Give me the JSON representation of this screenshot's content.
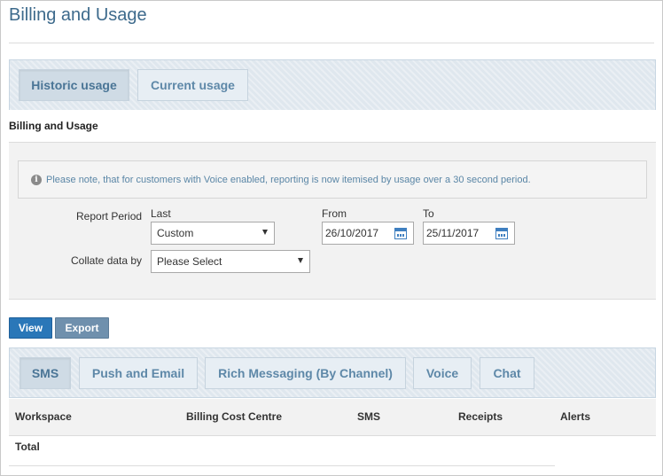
{
  "page": {
    "title": "Billing and Usage"
  },
  "usage_tabs": [
    {
      "label": "Historic usage",
      "active": true
    },
    {
      "label": "Current usage",
      "active": false
    }
  ],
  "section": {
    "label": "Billing and Usage"
  },
  "notice": {
    "text": "Please note, that for customers with Voice enabled, reporting is now itemised by usage over a 30 second period."
  },
  "form": {
    "report_period_label": "Report Period",
    "last_label": "Last",
    "last_value": "Custom",
    "from_label": "From",
    "from_value": "26/10/2017",
    "to_label": "To",
    "to_value": "25/11/2017",
    "collate_label": "Collate data by",
    "collate_value": "Please Select"
  },
  "buttons": {
    "view": "View",
    "export": "Export"
  },
  "channel_tabs": [
    {
      "label": "SMS",
      "active": true
    },
    {
      "label": "Push and Email",
      "active": false
    },
    {
      "label": "Rich Messaging (By Channel)",
      "active": false
    },
    {
      "label": "Voice",
      "active": false
    },
    {
      "label": "Chat",
      "active": false
    }
  ],
  "table": {
    "columns": [
      "Workspace",
      "Billing Cost Centre",
      "SMS",
      "Receipts",
      "Alerts"
    ],
    "total_label": "Total"
  },
  "colors": {
    "title": "#3d6a8c",
    "accent": "#2a77b8",
    "tab_text": "#5e88a8",
    "notice_text": "#5a86a6"
  },
  "icons": {
    "notice": "info-icon",
    "date": "calendar-icon",
    "select": "chevron-down-icon"
  }
}
